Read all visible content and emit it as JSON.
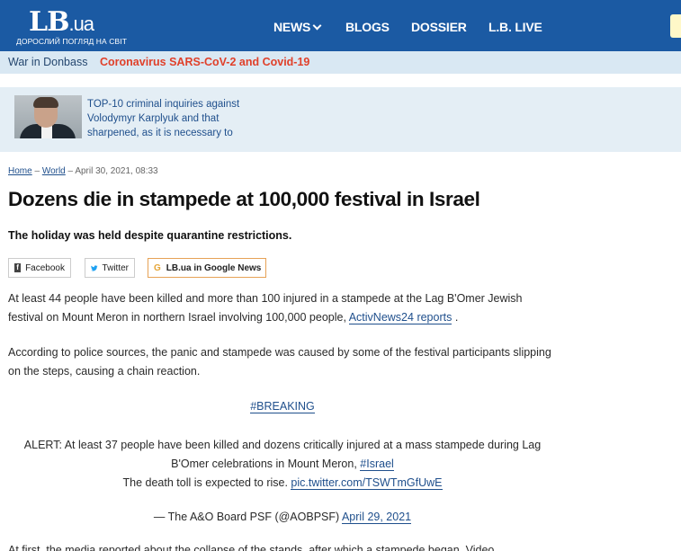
{
  "header": {
    "logo_main": "LB",
    "logo_suffix": ".ua",
    "logo_tagline": "ДОРОСЛИЙ ПОГЛЯД НА СВІТ",
    "nav": {
      "news": "NEWS",
      "blogs": "BLOGS",
      "dossier": "DOSSIER",
      "live": "L.B. LIVE"
    },
    "colors": {
      "brand": "#1b5aa3",
      "topics_bg": "#d9e8f3",
      "alert": "#e0402a"
    }
  },
  "topics": {
    "item1": "War in Donbass",
    "item2": "Coronavirus SARS-CoV-2 and Covid-19"
  },
  "promo": {
    "text": "TOP-10 criminal inquiries against Volodymyr Karplyuk and that sharpened, as it is necessary to"
  },
  "breadcrumb": {
    "home": "Home",
    "sep1": " – ",
    "section": "World",
    "sep2": " – ",
    "date": "April 30, 2021, 08:33"
  },
  "article": {
    "title": "Dozens die in stampede at 100,000 festival in Israel",
    "subtitle": "The holiday was held despite quarantine restrictions.",
    "share": {
      "facebook": "Facebook",
      "twitter": "Twitter",
      "google_news": "LB.ua in Google News"
    },
    "p1_text": "At least 44 people have been killed and more than 100 injured in a stampede at the Lag B'Omer Jewish festival on Mount Meron in northern Israel involving 100,000 people,",
    "p1_link": "ActivNews24 reports",
    "p1_end": " .",
    "p2": "According to police sources, the panic and stampede was caused by some of the festival participants slipping on the steps, causing a chain reaction.",
    "hashtag": "#BREAKING",
    "tweet_text": "ALERT: At least 37 people have been killed and dozens critically injured at a mass stampede during Lag B'Omer celebrations in Mount Meron,",
    "tweet_tag": "#Israel",
    "tweet_line2": "The death toll is expected to rise.",
    "tweet_pic": "pic.twitter.com/TSWTmGfUwE",
    "tweet_author": "— The A&O Board PSF (@AOBPSF)",
    "tweet_date": "April 29, 2021",
    "p3_partial": "At first, the media reported about the collapse of the stands, after which a stampede began. Video"
  }
}
